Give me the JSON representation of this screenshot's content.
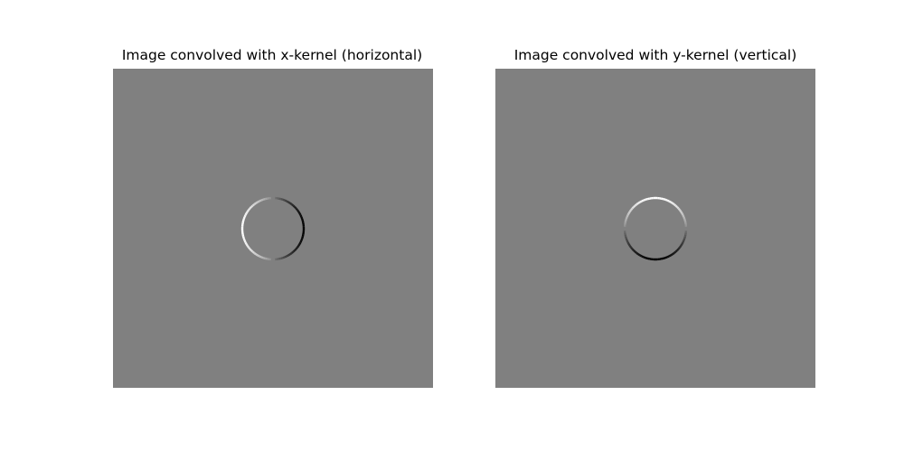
{
  "figure": {
    "panels": [
      {
        "title": "Image convolved with x-kernel (horizontal)",
        "image": "sobel-x-response-of-circle",
        "gradient_axis": "x"
      },
      {
        "title": "Image convolved with y-kernel (vertical)",
        "image": "sobel-y-response-of-circle",
        "gradient_axis": "y"
      }
    ],
    "colors": {
      "background_gray": "#808080",
      "positive_edge": "#ffffff",
      "negative_edge": "#000000"
    }
  }
}
